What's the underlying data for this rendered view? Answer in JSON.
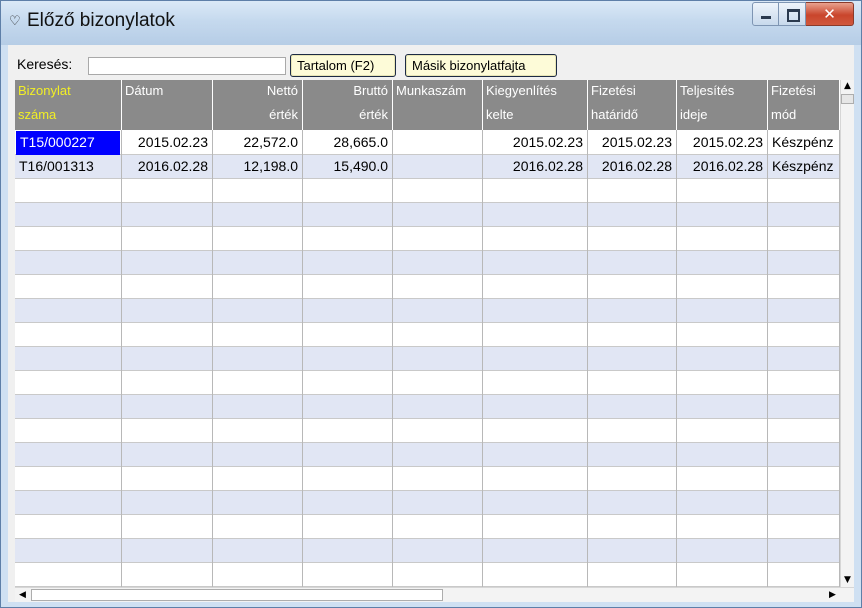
{
  "window": {
    "title": "Előző bizonylatok",
    "controls": [
      "minimize",
      "maximize",
      "close"
    ]
  },
  "search": {
    "label": "Keresés:",
    "value": ""
  },
  "buttons": {
    "content": "Tartalom (F2)",
    "other_type": "Másik bizonylatfajta"
  },
  "columns": [
    {
      "line1": "Bizonylat",
      "line2": "száma"
    },
    {
      "line1": "Dátum",
      "line2": ""
    },
    {
      "line1": "Nettó",
      "line2": "érték"
    },
    {
      "line1": "Bruttó",
      "line2": "érték"
    },
    {
      "line1": "Munkaszám",
      "line2": ""
    },
    {
      "line1": "Kiegyenlítés",
      "line2": "kelte"
    },
    {
      "line1": "Fizetési",
      "line2": "határidő"
    },
    {
      "line1": "Teljesítés",
      "line2": "ideje"
    },
    {
      "line1": "Fizetési",
      "line2": "mód"
    }
  ],
  "rows": [
    [
      "T15/000227",
      "2015.02.23",
      "22,572.0",
      "28,665.0",
      "",
      "2015.02.23",
      "2015.02.23",
      "2015.02.23",
      "Készpénz"
    ],
    [
      "T16/001313",
      "2016.02.28",
      "12,198.0",
      "15,490.0",
      "",
      "2016.02.28",
      "2016.02.28",
      "2016.02.28",
      "Készpénz"
    ]
  ],
  "colors": {
    "header_bg": "#8a8a8a",
    "selected_header_text": "#f2ef25",
    "selected_cell_bg": "#0000ff",
    "alt_row_bg": "#e1e6f4"
  }
}
